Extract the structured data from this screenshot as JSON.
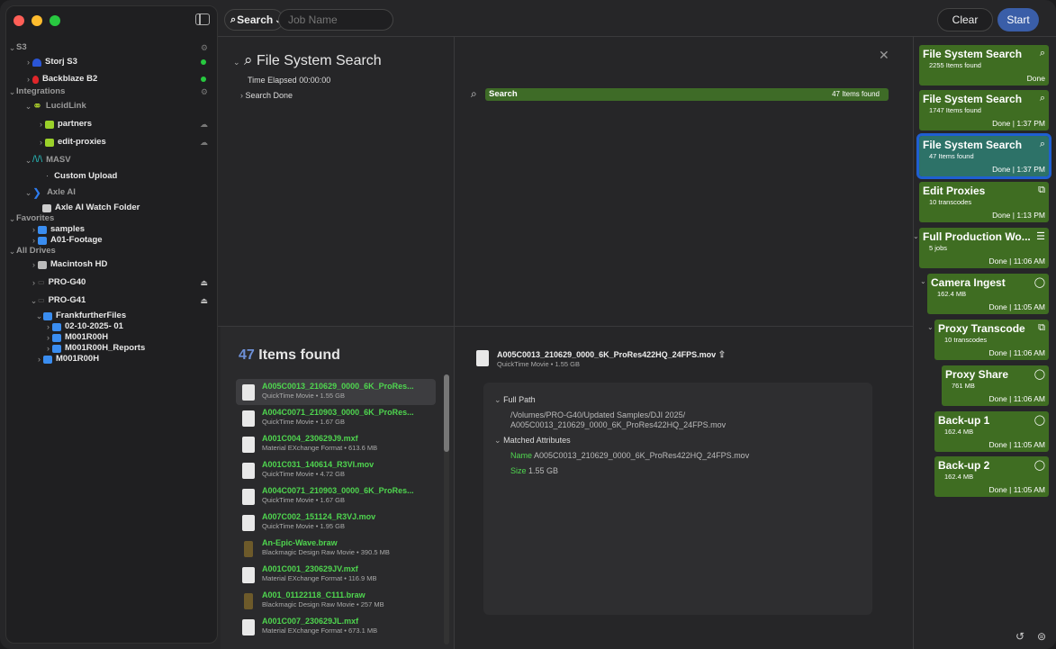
{
  "topbar": {
    "mode": "Search",
    "job_placeholder": "Job Name",
    "clear": "Clear",
    "start": "Start"
  },
  "sidebar": {
    "s3_header": "S3",
    "storj": "Storj S3",
    "backblaze": "Backblaze B2",
    "integrations": "Integrations",
    "lucidlink": "LucidLink",
    "partners": "partners",
    "edit_proxies": "edit-proxies",
    "masv": "MASV",
    "custom_upload": "Custom Upload",
    "axle": "Axle AI",
    "axle_watch": "Axle AI Watch Folder",
    "favorites": "Favorites",
    "samples": "samples",
    "a01": "A01-Footage",
    "all_drives": "All Drives",
    "mac": "Macintosh HD",
    "pro40": "PRO-G40",
    "pro41": "PRO-G41",
    "frank": "FrankfurtherFiles",
    "d1": "02-10-2025- 01",
    "d2": "M001R00H",
    "d3": "M001R00H_Reports",
    "d4": "M001R00H"
  },
  "search_panel": {
    "title": "File System Search",
    "time_label": "Time Elapsed 00:00:00",
    "search_status": "Search Done",
    "bar_label": "Search",
    "bar_count": "47 Items found"
  },
  "results": {
    "count": "47",
    "label": " Items found",
    "files": [
      {
        "name": "A005C0013_210629_0000_6K_ProRes...",
        "meta": "QuickTime Movie • 1.55 GB"
      },
      {
        "name": "A004C0071_210903_0000_6K_ProRes...",
        "meta": "QuickTime Movie • 1.67 GB"
      },
      {
        "name": "A001C004_230629J9.mxf",
        "meta": "Material EXchange Format • 613.6 MB"
      },
      {
        "name": "A001C031_140614_R3VI.mov",
        "meta": "QuickTime Movie • 4.72 GB"
      },
      {
        "name": "A004C0071_210903_0000_6K_ProRes...",
        "meta": "QuickTime Movie • 1.67 GB"
      },
      {
        "name": "A007C002_151124_R3VJ.mov",
        "meta": "QuickTime Movie • 1.95 GB"
      },
      {
        "name": "An-Epic-Wave.braw",
        "meta": "Blackmagic Design Raw Movie • 390.5 MB"
      },
      {
        "name": "A001C001_230629JV.mxf",
        "meta": "Material EXchange Format • 116.9 MB"
      },
      {
        "name": "A001_01122118_C111.braw",
        "meta": "Blackmagic Design Raw Movie • 257 MB"
      },
      {
        "name": "A001C007_230629JL.mxf",
        "meta": "Material EXchange Format • 673.1 MB"
      }
    ]
  },
  "detail": {
    "name": "A005C0013_210629_0000_6K_ProRes422HQ_24FPS.mov",
    "type": "QuickTime Movie • 1.55 GB",
    "full_path_label": "Full Path",
    "path1": "/Volumes/PRO-G40/Updated Samples/DJI 2025/",
    "path2": "A005C0013_210629_0000_6K_ProRes422HQ_24FPS.mov",
    "matched_label": "Matched Attributes",
    "name_key": "Name",
    "name_val": " A005C0013_210629_0000_6K_ProRes422HQ_24FPS.mov",
    "size_key": "Size",
    "size_val": " 1.55 GB"
  },
  "jobs": [
    {
      "title": "File System Search",
      "sub": "2255 Items found",
      "status": "Done"
    },
    {
      "title": "File System Search",
      "sub": "1747 Items found",
      "status": "Done | 1:37 PM"
    },
    {
      "title": "File System Search",
      "sub": "47 Items found",
      "status": "Done | 1:37 PM"
    },
    {
      "title": "Edit Proxies",
      "sub": "10 transcodes",
      "status": "Done | 1:13 PM"
    },
    {
      "title": "Full Production Wo...",
      "sub": "5 jobs",
      "status": "Done | 11:06 AM"
    },
    {
      "title": "Camera Ingest",
      "sub": "162.4 MB",
      "status": "Done | 11:05 AM"
    },
    {
      "title": "Proxy Transcode",
      "sub": "10 transcodes",
      "status": "Done | 11:06 AM"
    },
    {
      "title": "Proxy Share",
      "sub": "761 MB",
      "status": "Done | 11:06 AM"
    },
    {
      "title": "Back-up 1",
      "sub": "162.4 MB",
      "status": "Done | 11:05 AM"
    },
    {
      "title": "Back-up 2",
      "sub": "162.4 MB",
      "status": "Done | 11:05 AM"
    }
  ],
  "colors": {
    "accent": "#3a5ea8",
    "job_green": "#3f6d22",
    "match_green": "#4fd64f",
    "selected_outline": "#1f5fd1"
  }
}
